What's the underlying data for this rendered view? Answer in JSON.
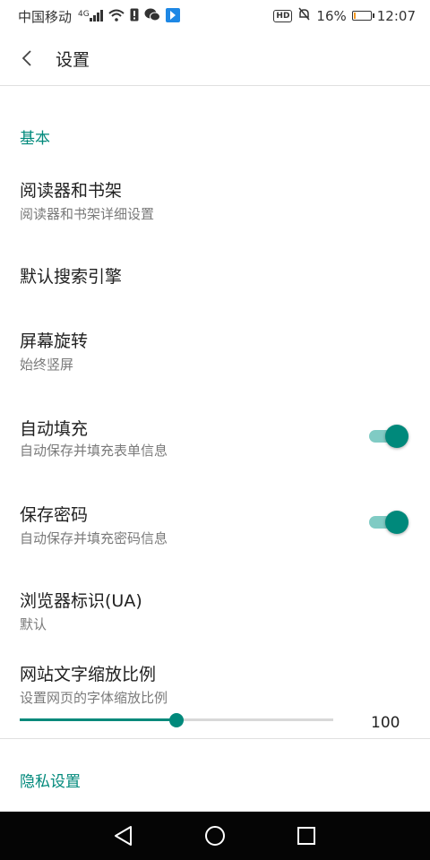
{
  "status_bar": {
    "carrier": "中国移动",
    "network": "4G",
    "battery_percent": "16%",
    "battery_level": 0.16,
    "time": "12:07",
    "hd_badge": "HD",
    "icons": [
      "signal-icon",
      "wifi-icon",
      "sim-alert-icon",
      "wechat-icon",
      "app-notification-icon",
      "hd-icon",
      "mute-bell-icon",
      "battery-icon"
    ]
  },
  "header": {
    "title": "设置",
    "back_icon": "chevron-left-icon"
  },
  "sections": {
    "basic": "基本",
    "privacy": "隐私设置"
  },
  "items": {
    "reader": {
      "title": "阅读器和书架",
      "subtitle": "阅读器和书架详细设置"
    },
    "search_engine": {
      "title": "默认搜索引擎"
    },
    "rotation": {
      "title": "屏幕旋转",
      "subtitle": "始终竖屏"
    },
    "autofill": {
      "title": "自动填充",
      "subtitle": "自动保存并填充表单信息",
      "enabled": true
    },
    "save_password": {
      "title": "保存密码",
      "subtitle": "自动保存并填充密码信息",
      "enabled": true
    },
    "user_agent": {
      "title": "浏览器标识(UA)",
      "subtitle": "默认"
    },
    "text_zoom": {
      "title": "网站文字缩放比例",
      "subtitle": "设置网页的字体缩放比例",
      "value": "100",
      "fraction": 0.5
    }
  },
  "colors": {
    "accent": "#00897b",
    "accent_light": "#80cbc4",
    "battery_low": "#f59a23",
    "nav_bar": "#050505"
  },
  "nav_bar": {
    "icons": [
      "back-triangle-icon",
      "home-circle-icon",
      "recents-square-icon"
    ]
  }
}
